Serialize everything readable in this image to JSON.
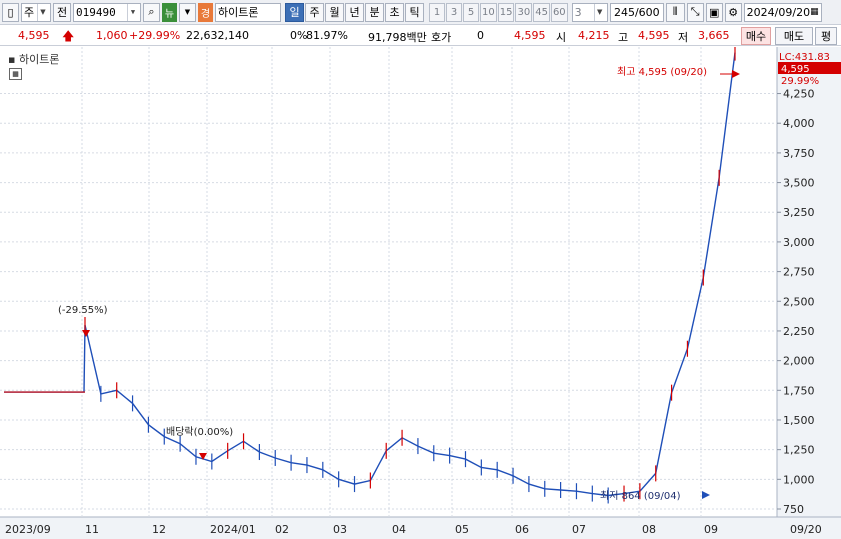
{
  "toolbar": {
    "market_type": "주",
    "market_prefix": "전",
    "stock_code": "019490",
    "news_label": "뉴",
    "alert_label": "경",
    "stock_name": "하이트론",
    "periods": [
      "일",
      "주",
      "월",
      "년",
      "분",
      "초",
      "틱"
    ],
    "active_period": "일",
    "intervals": [
      "1",
      "3",
      "5",
      "10",
      "15",
      "30",
      "45",
      "60"
    ],
    "interval_select": "3",
    "data_count": "245/600",
    "date": "2024/09/20"
  },
  "quote": {
    "price": "4,595",
    "change": "1,060",
    "change_rate": "+29.99%",
    "volume": "22,632,140",
    "ratio_label": "0%",
    "ratio_value": "81.97%",
    "amount": "91,798백만",
    "hoga_label": "호가",
    "hoga_value": "0",
    "current": "4,595",
    "open_label": "시",
    "open": "4,215",
    "high_label": "고",
    "high": "4,595",
    "low_label": "저",
    "low": "3,665",
    "buy_label": "매수",
    "sell_label": "매도",
    "eval_label": "평"
  },
  "chart": {
    "name": "하이트론",
    "last_price_label": "4,595",
    "last_rate_label": "29.99%",
    "lc_label": "LC:431.83",
    "annotation_high": "최고 4,595 (09/20)",
    "annotation_low": "최저 864 (09/04)",
    "annotation_drop": "(-29.55%)",
    "annotation_dividend": "배당락(0.00%)",
    "colors": {
      "up": "#d40000",
      "down": "#1f4fb8",
      "flat": "#d40000",
      "axis_bg": "#f0f3f7"
    }
  },
  "chart_data": {
    "type": "line",
    "title": "하이트론",
    "y_ticks": [
      750,
      1000,
      1250,
      1500,
      1750,
      2000,
      2250,
      2500,
      2750,
      3000,
      3250,
      3500,
      3750,
      4000,
      4250
    ],
    "x_ticks": [
      "2023/09",
      "11",
      "12",
      "2024/01",
      "02",
      "03",
      "04",
      "05",
      "06",
      "07",
      "08",
      "09",
      "09/20"
    ],
    "ylim": [
      750,
      4600
    ],
    "series": [
      {
        "values": [
          1735,
          1735,
          1735,
          2300,
          1720,
          1750,
          1640,
          1460,
          1360,
          1300,
          1190,
          1150,
          1240,
          1320,
          1230,
          1180,
          1140,
          1120,
          1080,
          1000,
          960,
          990,
          1240,
          1350,
          1280,
          1220,
          1200,
          1170,
          1100,
          1080,
          1030,
          960,
          920,
          910,
          900,
          880,
          864,
          880,
          900,
          1050,
          1730,
          2100,
          2700,
          3540,
          4595
        ]
      }
    ]
  }
}
